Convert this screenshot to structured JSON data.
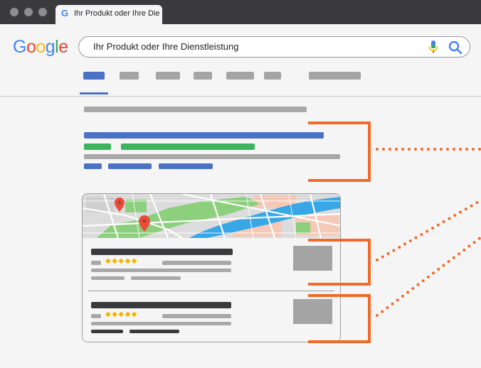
{
  "browser": {
    "tab_title": "Ihr Produkt oder Ihre Dienstleistung",
    "tab_favicon": "G"
  },
  "search": {
    "logo_letters": [
      "G",
      "o",
      "o",
      "g",
      "l",
      "e"
    ],
    "logo_colors": [
      "#4285F4",
      "#EA4335",
      "#FBBC05",
      "#4285F4",
      "#34A853",
      "#EA4335"
    ],
    "query": "Ihr Produkt oder Ihre Dienstleistung",
    "icons": [
      "mic-icon",
      "search-icon"
    ]
  },
  "local_results": {
    "result_1": {
      "rating_stars": "◆◆◆◆◆"
    },
    "result_2": {
      "rating_stars": "◆◆◆◆◆"
    }
  },
  "colors": {
    "accent_orange": "#f06a28",
    "result_blue": "#4a72c4",
    "result_green": "#3cb55e",
    "star_yellow": "#f6b400",
    "map_pin_red": "#ea4c3a",
    "map_water": "#37a7e6",
    "map_park": "#8ccf7d"
  }
}
